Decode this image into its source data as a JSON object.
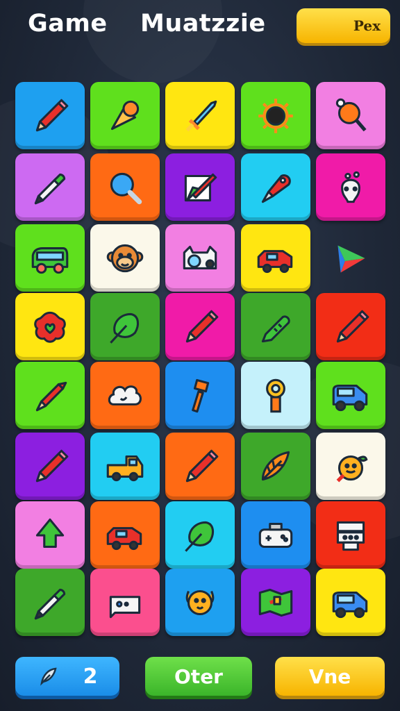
{
  "header": {
    "title_left": "Game",
    "title_right": "Muatzzie",
    "top_button": "Pex"
  },
  "tiles": [
    {
      "bg": "#1ea0f0",
      "icon": "pencil-icon"
    },
    {
      "bg": "#5fe01d",
      "icon": "ice-cream-icon"
    },
    {
      "bg": "#ffe611",
      "icon": "sword-icon"
    },
    {
      "bg": "#5fe01d",
      "icon": "sun-icon"
    },
    {
      "bg": "#f27fe2",
      "icon": "lollipop-icon"
    },
    {
      "bg": "#cd6af2",
      "icon": "marker-icon"
    },
    {
      "bg": "#ff6a14",
      "icon": "magnifier-icon"
    },
    {
      "bg": "#8c1fe0",
      "icon": "edit-icon"
    },
    {
      "bg": "#22cdf2",
      "icon": "brush-icon"
    },
    {
      "bg": "#f01ba8",
      "icon": "plant-icon"
    },
    {
      "bg": "#5fe01d",
      "icon": "bus-icon"
    },
    {
      "bg": "#fbf8ea",
      "icon": "monkey-icon"
    },
    {
      "bg": "#f27fe2",
      "icon": "camera-icon"
    },
    {
      "bg": "#ffe611",
      "icon": "car-icon"
    },
    {
      "bg": "",
      "icon": "play-icon"
    },
    {
      "bg": "#ffe611",
      "icon": "flower-icon"
    },
    {
      "bg": "#3ea82a",
      "icon": "leaf-icon"
    },
    {
      "bg": "#f01ba8",
      "icon": "pencil-icon"
    },
    {
      "bg": "#3ea82a",
      "icon": "thermometer-icon"
    },
    {
      "bg": "#f22d16",
      "icon": "pencil-icon"
    },
    {
      "bg": "#5fe01d",
      "icon": "crayon-icon"
    },
    {
      "bg": "#ff6a14",
      "icon": "cloud-icon"
    },
    {
      "bg": "#1e8ef0",
      "icon": "hammer-icon"
    },
    {
      "bg": "#c5f1fb",
      "icon": "key-icon"
    },
    {
      "bg": "#5fe01d",
      "icon": "van-icon"
    },
    {
      "bg": "#8c1fe0",
      "icon": "pencil-icon"
    },
    {
      "bg": "#22cdf2",
      "icon": "truck-icon"
    },
    {
      "bg": "#ff6a14",
      "icon": "pencil-icon"
    },
    {
      "bg": "#3ea82a",
      "icon": "feather-icon"
    },
    {
      "bg": "#fbf8ea",
      "icon": "fruit-icon"
    },
    {
      "bg": "#f27fe2",
      "icon": "tree-icon"
    },
    {
      "bg": "#ff6a14",
      "icon": "car-icon"
    },
    {
      "bg": "#22cdf2",
      "icon": "leaf-icon"
    },
    {
      "bg": "#1e8ef0",
      "icon": "gamepad-icon"
    },
    {
      "bg": "#f22d16",
      "icon": "robot-icon"
    },
    {
      "bg": "#3ea82a",
      "icon": "marker-icon"
    },
    {
      "bg": "#fb4f8e",
      "icon": "tablet-icon"
    },
    {
      "bg": "#1ea0f0",
      "icon": "puppy-icon"
    },
    {
      "bg": "#8c1fe0",
      "icon": "map-icon"
    },
    {
      "bg": "#ffe611",
      "icon": "van-icon"
    }
  ],
  "footer": {
    "hint_count": "2",
    "middle_button": "Oter",
    "right_button": "Vne"
  },
  "colors": {
    "background": "#1f2838",
    "gold": "#f7b400",
    "green_button": "#3bb52a",
    "blue_button": "#1a8de8"
  }
}
